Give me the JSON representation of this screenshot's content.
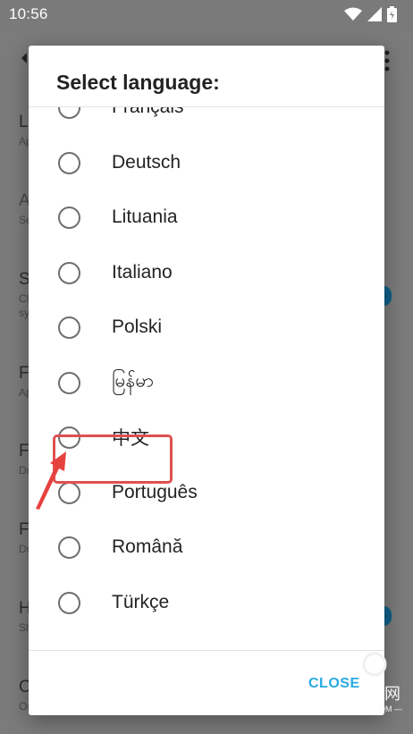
{
  "status_bar": {
    "time": "10:56"
  },
  "background": {
    "rows": [
      {
        "title": "L",
        "subtitle": "Ap"
      },
      {
        "title": "A",
        "subtitle": "Se"
      },
      {
        "title": "S",
        "subtitle": "Ch",
        "subtitle2": "sy"
      },
      {
        "title": "F",
        "subtitle": "Ap"
      },
      {
        "title": "F",
        "subtitle": "Dr"
      },
      {
        "title": "F",
        "subtitle": "Dr"
      },
      {
        "title": "H",
        "subtitle": "Sh"
      },
      {
        "title": "O",
        "subtitle": "Or"
      }
    ]
  },
  "dialog": {
    "title": "Select language:",
    "options": [
      {
        "label": "Français",
        "selected": false
      },
      {
        "label": "Deutsch",
        "selected": false
      },
      {
        "label": "Lituania",
        "selected": false
      },
      {
        "label": "Italiano",
        "selected": false
      },
      {
        "label": "Polski",
        "selected": false
      },
      {
        "label": "မြန်မာ",
        "selected": false
      },
      {
        "label": "中文",
        "selected": false
      },
      {
        "label": "Português",
        "selected": false
      },
      {
        "label": "Română",
        "selected": false
      },
      {
        "label": "Türkçe",
        "selected": false
      }
    ],
    "close_label": "CLOSE"
  },
  "colors": {
    "accent": "#29a9e1",
    "highlight": "#e05050",
    "scrim": "#7a7a7a"
  },
  "watermark": {
    "text": "网",
    "small": "OM —"
  }
}
